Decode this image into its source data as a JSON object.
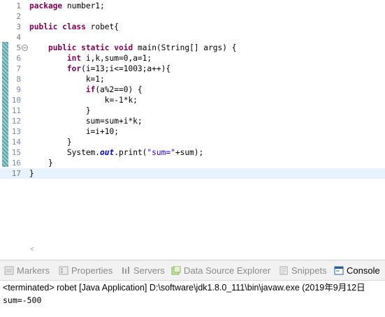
{
  "editor": {
    "lines": [
      {
        "n": "1",
        "tokens": [
          {
            "t": "package",
            "c": "kw"
          },
          {
            "t": " number1;"
          }
        ]
      },
      {
        "n": "2",
        "tokens": []
      },
      {
        "n": "3",
        "tokens": [
          {
            "t": "public",
            "c": "kw"
          },
          {
            "t": " "
          },
          {
            "t": "class",
            "c": "kw"
          },
          {
            "t": " robet{"
          }
        ]
      },
      {
        "n": "4",
        "tokens": []
      },
      {
        "n": "5",
        "tokens": [
          {
            "t": "    "
          },
          {
            "t": "public",
            "c": "kw"
          },
          {
            "t": " "
          },
          {
            "t": "static",
            "c": "kw"
          },
          {
            "t": " "
          },
          {
            "t": "void",
            "c": "kw"
          },
          {
            "t": " main(String[] args) {"
          }
        ]
      },
      {
        "n": "6",
        "tokens": [
          {
            "t": "        "
          },
          {
            "t": "int",
            "c": "kw"
          },
          {
            "t": " i,k,sum=0,a=1;"
          }
        ]
      },
      {
        "n": "7",
        "tokens": [
          {
            "t": "        "
          },
          {
            "t": "for",
            "c": "kw"
          },
          {
            "t": "(i=13;i<=1003;a++){"
          }
        ]
      },
      {
        "n": "8",
        "tokens": [
          {
            "t": "            k=1;"
          }
        ]
      },
      {
        "n": "9",
        "tokens": [
          {
            "t": "            "
          },
          {
            "t": "if",
            "c": "kw"
          },
          {
            "t": "(a%2==0) {"
          }
        ]
      },
      {
        "n": "10",
        "tokens": [
          {
            "t": "                k=-1*k;"
          }
        ]
      },
      {
        "n": "11",
        "tokens": [
          {
            "t": "            }"
          }
        ]
      },
      {
        "n": "12",
        "tokens": [
          {
            "t": "            sum=sum+i*k;"
          }
        ]
      },
      {
        "n": "13",
        "tokens": [
          {
            "t": "            i=i+10;"
          }
        ]
      },
      {
        "n": "14",
        "tokens": [
          {
            "t": "        }"
          }
        ]
      },
      {
        "n": "15",
        "tokens": [
          {
            "t": "        System."
          },
          {
            "t": "out",
            "c": "fld"
          },
          {
            "t": ".print("
          },
          {
            "t": "\"sum=\"",
            "c": "str"
          },
          {
            "t": "+sum);"
          }
        ]
      },
      {
        "n": "16",
        "tokens": [
          {
            "t": "    }"
          }
        ]
      },
      {
        "n": "17",
        "tokens": [
          {
            "t": "}"
          }
        ]
      }
    ],
    "modified_lines": [
      "6",
      "7",
      "8",
      "9",
      "10",
      "11",
      "12",
      "13",
      "14",
      "15",
      "16"
    ],
    "fold_marker": "−",
    "current_line": "17",
    "scroll_left_arrow": "<"
  },
  "views": {
    "tabs": [
      {
        "label": "Markers",
        "icon": "markers-icon"
      },
      {
        "label": "Properties",
        "icon": "properties-icon"
      },
      {
        "label": "Servers",
        "icon": "servers-icon"
      },
      {
        "label": "Data Source Explorer",
        "icon": "data-source-icon"
      },
      {
        "label": "Snippets",
        "icon": "snippets-icon"
      },
      {
        "label": "Console",
        "icon": "console-icon",
        "active": true
      }
    ],
    "console": {
      "status": "<terminated> robet [Java Application] D:\\software\\jdk1.8.0_111\\bin\\javaw.exe (2019年9月12日",
      "output": "sum=-500"
    }
  },
  "colors": {
    "keyword": "#7f0055",
    "string": "#2a00ff",
    "field": "#0000c0",
    "current_line": "#e8f2fe"
  }
}
